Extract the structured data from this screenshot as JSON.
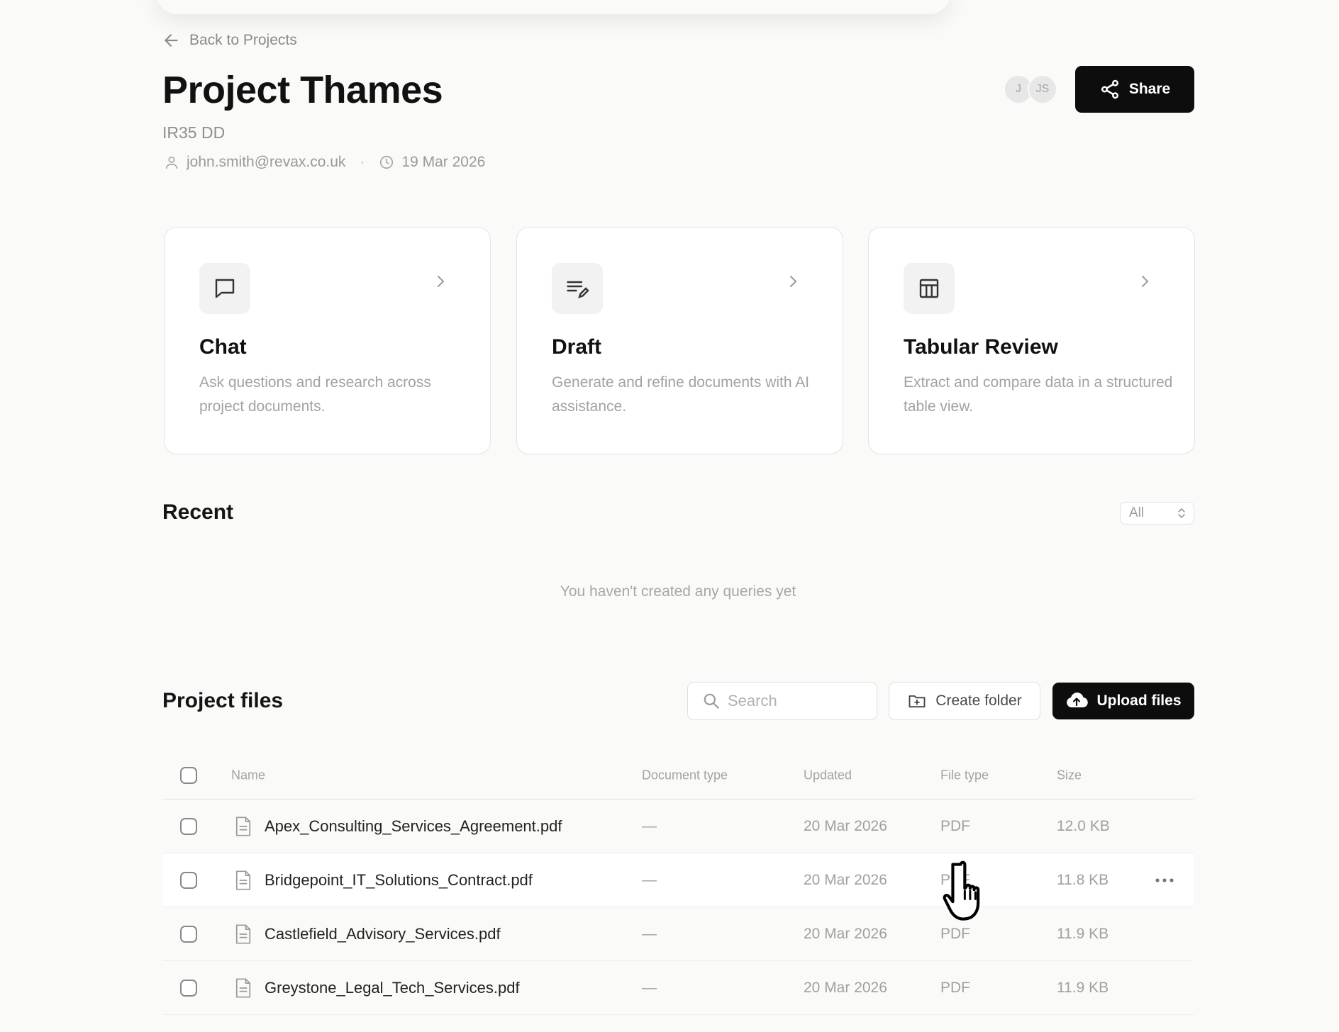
{
  "nav": {
    "back_label": "Back to Projects"
  },
  "project": {
    "title": "Project Thames",
    "subtitle": "IR35 DD",
    "owner_email": "john.smith@revax.co.uk",
    "separator": "·",
    "date": "19 Mar 2026"
  },
  "collaborators": [
    "J",
    "JS"
  ],
  "share": {
    "label": "Share"
  },
  "cards": [
    {
      "title": "Chat",
      "description": "Ask questions and research across project documents.",
      "icon": "chat-bubble-icon"
    },
    {
      "title": "Draft",
      "description": "Generate and refine documents with AI assistance.",
      "icon": "draft-edit-icon"
    },
    {
      "title": "Tabular Review",
      "description": "Extract and compare data in a structured table view.",
      "icon": "table-icon"
    }
  ],
  "recent": {
    "title": "Recent",
    "filter_value": "All",
    "empty_message": "You haven't created any queries yet"
  },
  "files": {
    "title": "Project files",
    "search_placeholder": "Search",
    "create_folder_label": "Create folder",
    "upload_label": "Upload files",
    "columns": [
      "Name",
      "Document type",
      "Updated",
      "File type",
      "Size"
    ],
    "rows": [
      {
        "name": "Apex_Consulting_Services_Agreement.pdf",
        "doc_type": "—",
        "updated": "20 Mar 2026",
        "file_type": "PDF",
        "size": "12.0 KB"
      },
      {
        "name": "Bridgepoint_IT_Solutions_Contract.pdf",
        "doc_type": "—",
        "updated": "20 Mar 2026",
        "file_type": "PDF",
        "size": "11.8 KB"
      },
      {
        "name": "Castlefield_Advisory_Services.pdf",
        "doc_type": "—",
        "updated": "20 Mar 2026",
        "file_type": "PDF",
        "size": "11.9 KB"
      },
      {
        "name": "Greystone_Legal_Tech_Services.pdf",
        "doc_type": "—",
        "updated": "20 Mar 2026",
        "file_type": "PDF",
        "size": "11.9 KB"
      }
    ]
  },
  "colors": {
    "primary_button": "#0d0d0d",
    "muted_text": "#a0a0a0",
    "background": "#fafaf9"
  }
}
